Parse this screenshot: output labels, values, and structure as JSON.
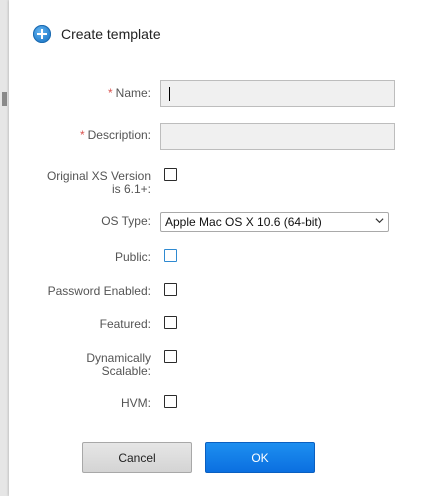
{
  "dialog": {
    "title": "Create template",
    "title_icon": "plus-circle-icon"
  },
  "form": {
    "name": {
      "label": "Name:",
      "required_mark": "*",
      "value": "",
      "placeholder": ""
    },
    "description": {
      "label": "Description:",
      "required_mark": "*",
      "value": "",
      "placeholder": ""
    },
    "original_xs_version": {
      "label_line1": "Original XS Version",
      "label_line2": "is 6.1+:",
      "checked": false
    },
    "os_type": {
      "label": "OS Type:",
      "selected": "Apple Mac OS X 10.6 (64-bit)"
    },
    "public": {
      "label": "Public:",
      "checked": false
    },
    "password_enabled": {
      "label": "Password Enabled:",
      "checked": false
    },
    "featured": {
      "label": "Featured:",
      "checked": false
    },
    "dynamically_scalable": {
      "label_line1": "Dynamically",
      "label_line2": "Scalable:",
      "checked": false
    },
    "hvm": {
      "label": "HVM:",
      "checked": false
    }
  },
  "buttons": {
    "cancel": "Cancel",
    "ok": "OK"
  },
  "colors": {
    "required": "#d9534f",
    "primary_button": "#0b6fe0",
    "focus_checkbox": "#2f8ad1"
  }
}
